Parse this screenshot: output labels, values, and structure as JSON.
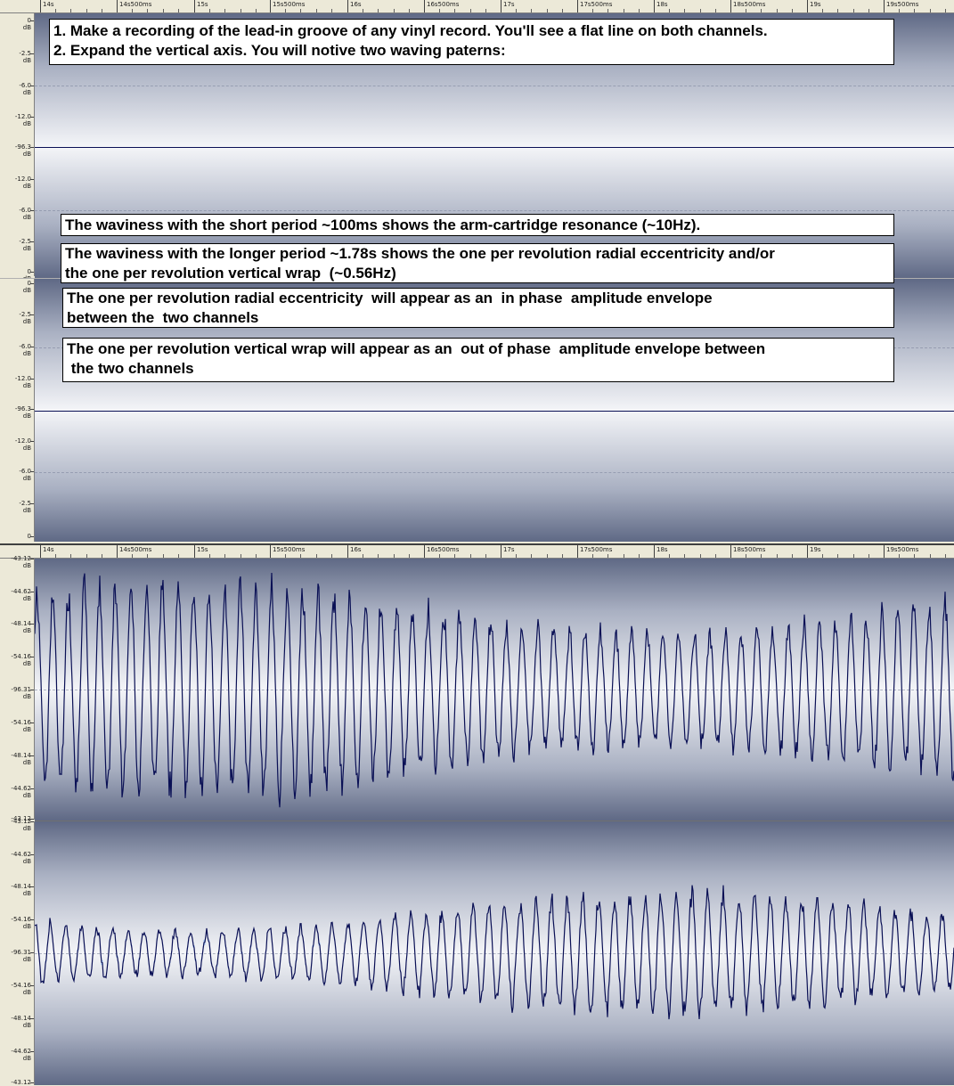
{
  "ruler": {
    "labels": [
      "14s",
      "14s500ms",
      "15s",
      "15s500ms",
      "16s",
      "16s500ms",
      "17s",
      "17s500ms",
      "18s",
      "18s500ms",
      "19s",
      "19s500ms"
    ]
  },
  "top_view": {
    "y_labels_upper": [
      "0\ndB",
      "-2.5\ndB",
      "-6.0\ndB",
      "-12.0\ndB",
      "-96.3\ndB",
      "-12.0\ndB",
      "-6.0\ndB",
      "-2.5\ndB",
      "0\ndB"
    ],
    "y_labels_lower": [
      "0\ndB",
      "-2.5\ndB",
      "-6.0\ndB",
      "-12.0\ndB",
      "-96.3\ndB",
      "-12.0\ndB",
      "-6.0\ndB",
      "-2.5\ndB",
      "0"
    ]
  },
  "notes": {
    "step1": "1. Make a recording of the lead-in groove of any vinyl record. You'll see a flat line on both channels.",
    "step2": "2. Expand the vertical axis. You will notive two waving paterns:",
    "short_period": "The waviness with the short period ~100ms shows the arm-cartridge resonance (~10Hz).",
    "long_period_1": "The waviness with the longer period ~1.78s shows the one per revolution radial eccentricity and/or",
    "long_period_2": "the one per revolution vertical wrap  (~0.56Hz)",
    "radial_1": "The one per revolution radial eccentricity  will appear as an  in phase  amplitude envelope",
    "radial_2": "between the  two channels",
    "vertical_1": "The one per revolution vertical wrap will appear as an  out of phase  amplitude envelope between",
    "vertical_2": " the two channels"
  },
  "bottom_view": {
    "y_labels_upper": [
      "-43.12\ndB",
      "-44.62\ndB",
      "-48.14\ndB",
      "-54.16\ndB",
      "-96.31\ndB",
      "-54.16\ndB",
      "-48.14\ndB",
      "-44.62\ndB",
      "-43.12"
    ],
    "y_labels_lower": [
      "-43.12\ndB",
      "-44.62\ndB",
      "-48.14\ndB",
      "-54.16\ndB",
      "-96.31\ndB",
      "-54.16\ndB",
      "-48.14\ndB",
      "-44.62\ndB",
      "-43.12"
    ]
  },
  "colors": {
    "wave_stroke": "#0a1055",
    "wave_fill": "#9fc3f5"
  }
}
